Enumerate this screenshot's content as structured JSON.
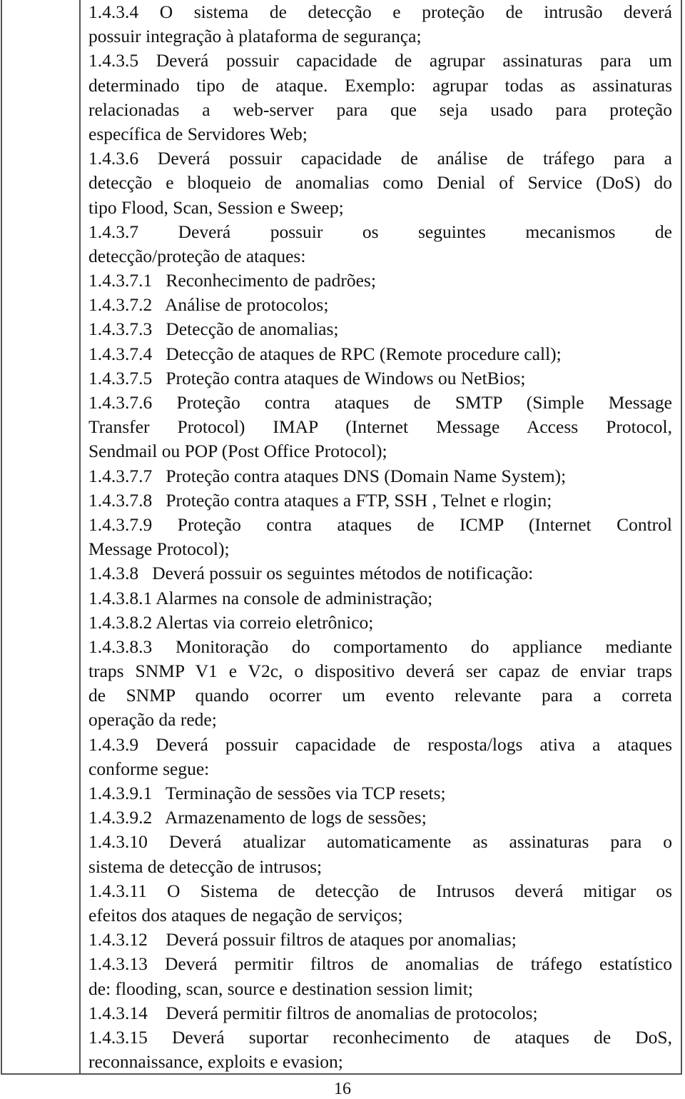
{
  "document": {
    "lines": [
      {
        "text": "1.4.3.4  O sistema de detecção e proteção de intrusão deverá",
        "justify": true
      },
      {
        "text": "possuir integração à plataforma de segurança;",
        "justify": false
      },
      {
        "text": "1.4.3.5  Deverá possuir capacidade de agrupar assinaturas para um",
        "justify": true
      },
      {
        "text": "determinado tipo de ataque. Exemplo: agrupar todas as assinaturas",
        "justify": true
      },
      {
        "text": "relacionadas a web-server para que seja usado para proteção",
        "justify": true
      },
      {
        "text": "específica de Servidores Web;",
        "justify": false
      },
      {
        "text": "1.4.3.6 Deverá possuir capacidade de análise de tráfego para a",
        "justify": true
      },
      {
        "text": "detecção e bloqueio de anomalias como Denial of Service (DoS) do",
        "justify": true
      },
      {
        "text": "tipo Flood, Scan, Session e Sweep;",
        "justify": false
      },
      {
        "text": "1.4.3.7 Deverá possuir os seguintes mecanismos de",
        "justify": true
      },
      {
        "text": "detecção/proteção de ataques:",
        "justify": false
      },
      {
        "text": "1.4.3.7.1   Reconhecimento de padrões;",
        "justify": false
      },
      {
        "text": "1.4.3.7.2   Análise de protocolos;",
        "justify": false
      },
      {
        "text": "1.4.3.7.3   Detecção de anomalias;",
        "justify": false
      },
      {
        "text": "1.4.3.7.4   Detecção de ataques de RPC (Remote procedure call);",
        "justify": false
      },
      {
        "text": "1.4.3.7.5   Proteção contra ataques de Windows ou NetBios;",
        "justify": false
      },
      {
        "text": "1.4.3.7.6   Proteção contra ataques de SMTP (Simple Message",
        "justify": true
      },
      {
        "text": "Transfer Protocol) IMAP (Internet Message Access Protocol,",
        "justify": true
      },
      {
        "text": "Sendmail ou POP (Post Office Protocol);",
        "justify": false
      },
      {
        "text": "1.4.3.7.7   Proteção contra ataques DNS (Domain Name System);",
        "justify": false
      },
      {
        "text": "1.4.3.7.8   Proteção contra ataques a FTP, SSH , Telnet e rlogin;",
        "justify": false
      },
      {
        "text": "1.4.3.7.9   Proteção contra ataques de ICMP (Internet Control",
        "justify": true
      },
      {
        "text": "Message Protocol);",
        "justify": false
      },
      {
        "text": "1.4.3.8   Deverá possuir os seguintes métodos de notificação:",
        "justify": false
      },
      {
        "text": "1.4.3.8.1 Alarmes na console de administração;",
        "justify": false
      },
      {
        "text": "1.4.3.8.2 Alertas via correio eletrônico;",
        "justify": false
      },
      {
        "text": "1.4.3.8.3   Monitoração do comportamento do appliance mediante",
        "justify": true
      },
      {
        "text": "traps SNMP V1 e V2c, o dispositivo deverá ser capaz de enviar traps",
        "justify": true
      },
      {
        "text": "de SNMP quando ocorrer um evento relevante para a correta",
        "justify": true
      },
      {
        "text": "operação da rede;",
        "justify": false
      },
      {
        "text": "1.4.3.9   Deverá possuir capacidade de resposta/logs ativa a ataques",
        "justify": true
      },
      {
        "text": "conforme segue:",
        "justify": false
      },
      {
        "text": "1.4.3.9.1   Terminação de sessões via TCP resets;",
        "justify": false
      },
      {
        "text": "1.4.3.9.2   Armazenamento de logs de sessões;",
        "justify": false
      },
      {
        "text": "1.4.3.10   Deverá atualizar automaticamente as assinaturas para o",
        "justify": true
      },
      {
        "text": "sistema de detecção de intrusos;",
        "justify": false
      },
      {
        "text": "1.4.3.11   O Sistema de detecção de Intrusos deverá mitigar os",
        "justify": true
      },
      {
        "text": "efeitos dos ataques de negação de serviços;",
        "justify": false
      },
      {
        "text": "1.4.3.12    Deverá possuir filtros de ataques por anomalias;",
        "justify": false
      },
      {
        "text": "1.4.3.13    Deverá permitir filtros de anomalias de tráfego estatístico",
        "justify": true
      },
      {
        "text": "de: flooding, scan, source e destination session limit;",
        "justify": false
      },
      {
        "text": "1.4.3.14    Deverá permitir filtros de anomalias de protocolos;",
        "justify": false
      },
      {
        "text": "1.4.3.15    Deverá suportar reconhecimento de ataques de DoS,",
        "justify": true
      },
      {
        "text": "reconnaissance, exploits e evasion;",
        "justify": false
      }
    ]
  },
  "footer": {
    "page_number": "16"
  }
}
